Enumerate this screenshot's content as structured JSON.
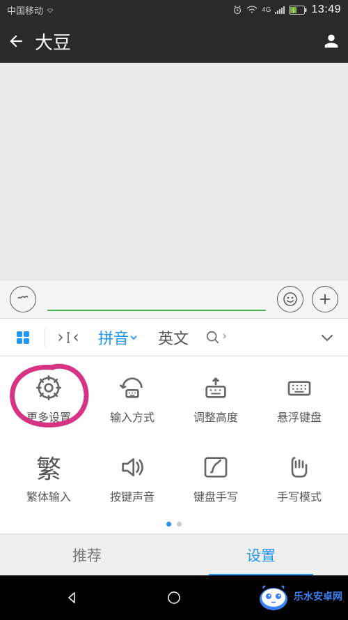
{
  "status": {
    "carrier": "中国移动",
    "network": "4G",
    "time": "13:49"
  },
  "nav": {
    "title": "大豆"
  },
  "ime_toolbar": {
    "pinyin": "拼音",
    "english": "英文"
  },
  "settings": {
    "items": [
      {
        "label": "更多设置",
        "icon": "gear-icon"
      },
      {
        "label": "输入方式",
        "icon": "input-mode-icon"
      },
      {
        "label": "调整高度",
        "icon": "height-icon"
      },
      {
        "label": "悬浮键盘",
        "icon": "floating-kb-icon"
      },
      {
        "label": "繁体输入",
        "icon": "fan-char",
        "char": "繁"
      },
      {
        "label": "按键声音",
        "icon": "sound-icon"
      },
      {
        "label": "键盘手写",
        "icon": "kb-handwrite-icon"
      },
      {
        "label": "手写模式",
        "icon": "handwrite-icon"
      }
    ]
  },
  "tabs": {
    "recommend": "推荐",
    "settings": "设置"
  },
  "watermark": {
    "text": "乐水安卓网"
  }
}
